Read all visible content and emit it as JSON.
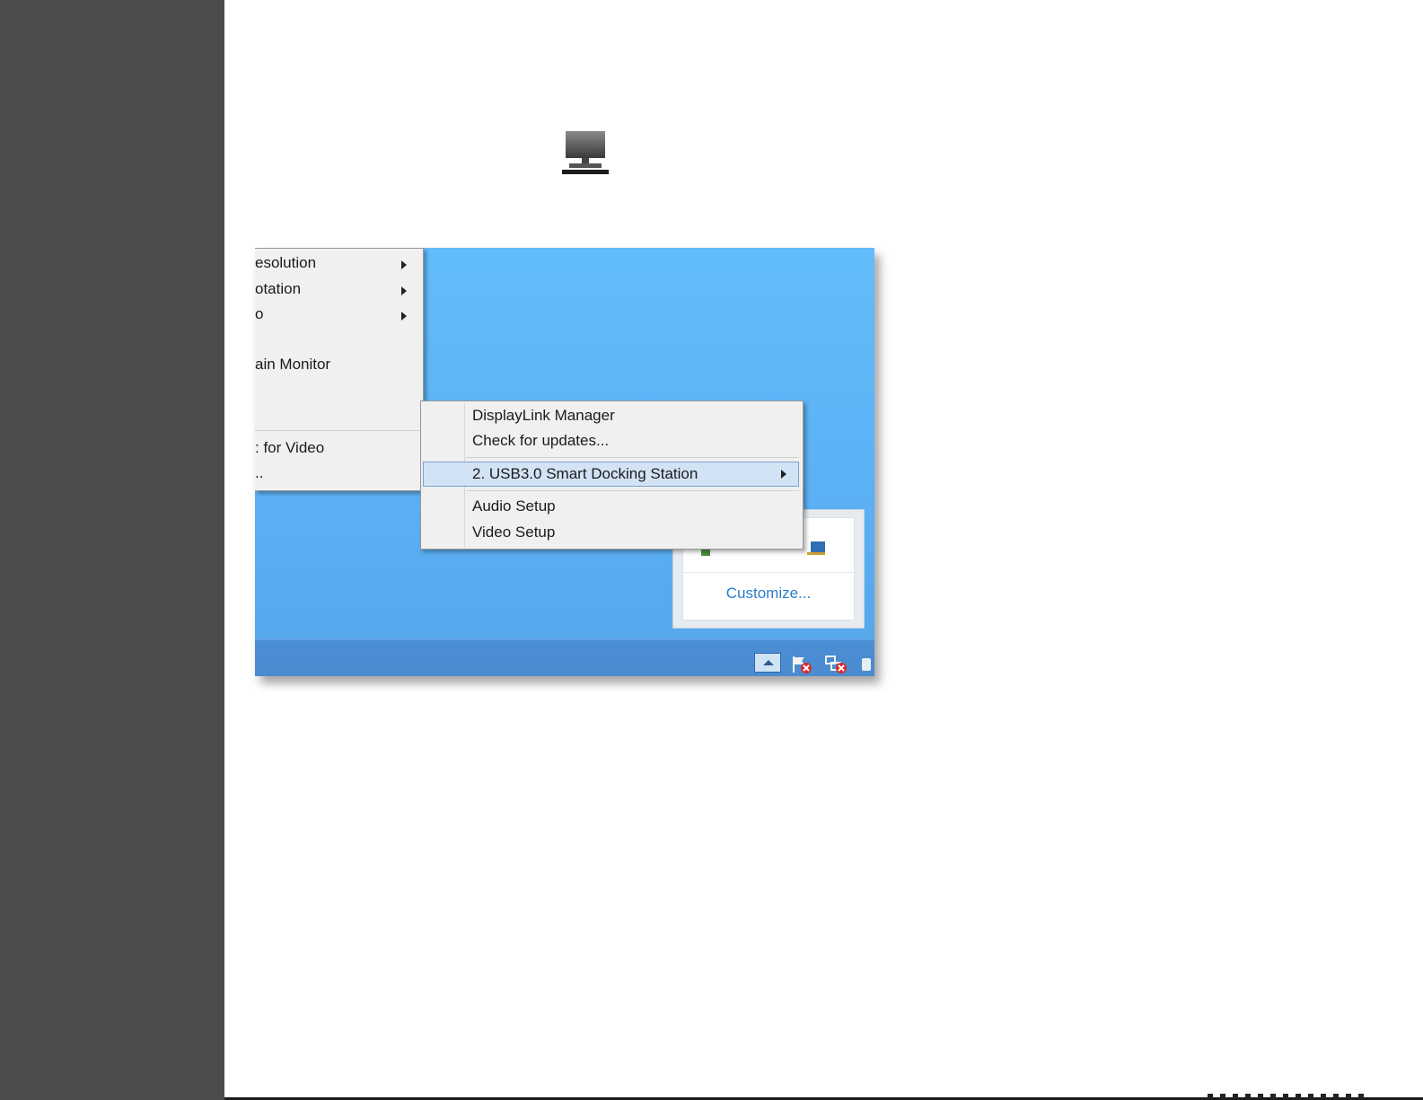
{
  "icons": {
    "standalone": "displaylink-icon",
    "tray": [
      "show-hidden-icons-icon",
      "action-center-flag-icon",
      "network-error-icon",
      "speaker-icon"
    ]
  },
  "left_menu": {
    "items": [
      {
        "label": "esolution",
        "submenu": true
      },
      {
        "label": "otation",
        "submenu": true
      },
      {
        "label": "o",
        "submenu": true
      },
      {
        "label": "ain Monitor",
        "submenu": false
      },
      {
        "label": ": for Video",
        "submenu": false
      },
      {
        "label": "..",
        "submenu": false
      }
    ]
  },
  "right_menu": {
    "items": [
      {
        "label": "DisplayLink Manager"
      },
      {
        "label": "Check for updates..."
      },
      {
        "label": "2. USB3.0 Smart Docking Station",
        "submenu": true,
        "highlighted": true
      },
      {
        "label": "Audio Setup"
      },
      {
        "label": "Video Setup"
      }
    ]
  },
  "overflow_panel": {
    "customize_label": "Customize..."
  },
  "colors": {
    "sidebar": "#4d4c4c",
    "desktop": "#5cb1f4",
    "taskbar": "#4a8ed4",
    "menu_bg": "#f0f0f0",
    "highlight": "#d1e3f4",
    "link": "#2a7fc9"
  }
}
